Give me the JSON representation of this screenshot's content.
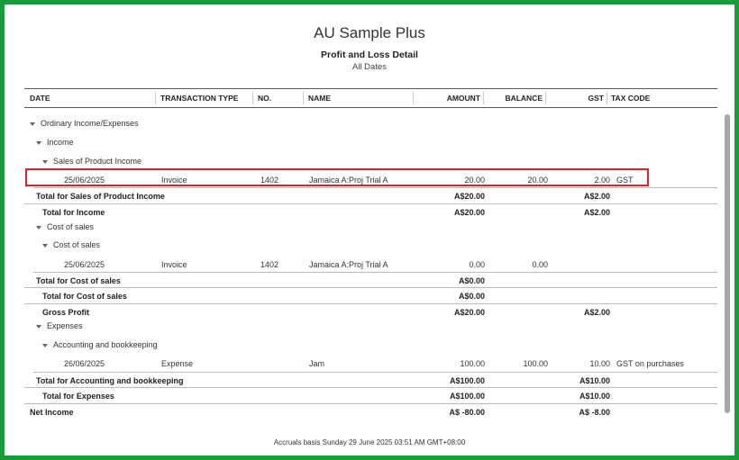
{
  "report": {
    "company": "AU Sample Plus",
    "title": "Profit and Loss Detail",
    "subtitle": "All Dates"
  },
  "columns": {
    "date": "DATE",
    "type": "TRANSACTION TYPE",
    "no": "NO.",
    "name": "NAME",
    "amount": "AMOUNT",
    "balance": "BALANCE",
    "gst": "GST",
    "tax": "TAX CODE"
  },
  "sections": {
    "ordinary": "Ordinary Income/Expenses",
    "income": "Income",
    "sales": "Sales of Product Income",
    "cost_of_sales_group": "Cost of sales",
    "cost_of_sales": "Cost of sales",
    "expenses": "Expenses",
    "accounting": "Accounting and bookkeeping"
  },
  "transactions": [
    {
      "date": "25/06/2025",
      "type": "Invoice",
      "no": "1402",
      "name": "Jamaica A:Proj Trial A",
      "amount": "20.00",
      "balance": "20.00",
      "gst": "2.00",
      "tax": "GST"
    },
    {
      "date": "25/06/2025",
      "type": "Invoice",
      "no": "1402",
      "name": "Jamaica A:Proj Trial A",
      "amount": "0.00",
      "balance": "0.00",
      "gst": "",
      "tax": ""
    },
    {
      "date": "26/06/2025",
      "type": "Expense",
      "no": "",
      "name": "Jam",
      "amount": "100.00",
      "balance": "100.00",
      "gst": "10.00",
      "tax": "GST on purchases"
    }
  ],
  "totals": {
    "sales": {
      "label": "Total for Sales of Product Income",
      "amount": "A$20.00",
      "gst": "A$2.00"
    },
    "income": {
      "label": "Total for Income",
      "amount": "A$20.00",
      "gst": "A$2.00"
    },
    "cost_inner": {
      "label": "Total for Cost of sales",
      "amount": "A$0.00"
    },
    "cost_outer": {
      "label": "Total for Cost of sales",
      "amount": "A$0.00"
    },
    "gross": {
      "label": "Gross Profit",
      "amount": "A$20.00",
      "gst": "A$2.00"
    },
    "accounting": {
      "label": "Total for Accounting and bookkeeping",
      "amount": "A$100.00",
      "gst": "A$10.00"
    },
    "expenses": {
      "label": "Total for Expenses",
      "amount": "A$100.00",
      "gst": "A$10.00"
    },
    "net": {
      "label": "Net Income",
      "amount": "A$ -80.00",
      "gst": "A$ -8.00"
    }
  },
  "footer": "Accruals basis  Sunday 29 June 2025  03:51 AM GMT+08:00"
}
